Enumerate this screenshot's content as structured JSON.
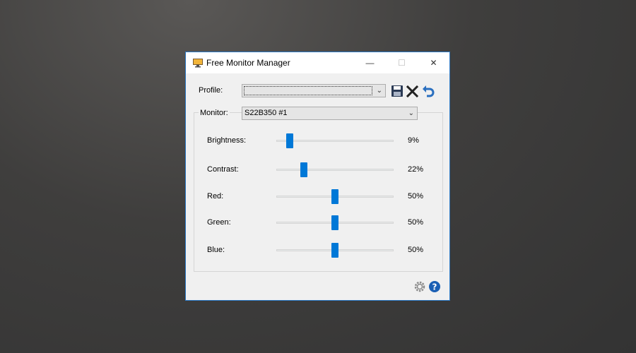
{
  "window": {
    "title": "Free Monitor Manager",
    "controls": {
      "minimize": "—",
      "maximize": "☐",
      "close": "✕"
    }
  },
  "profile": {
    "label": "Profile:",
    "value": "",
    "icons": [
      "save-icon",
      "delete-icon",
      "undo-icon"
    ]
  },
  "monitor": {
    "label": "Monitor:",
    "value": "S22B350 #1"
  },
  "sliders": [
    {
      "label": "Brightness:",
      "value": 9,
      "display": "9%"
    },
    {
      "label": "Contrast:",
      "value": 22,
      "display": "22%"
    },
    {
      "label": "Red:",
      "value": 50,
      "display": "50%"
    },
    {
      "label": "Green:",
      "value": 50,
      "display": "50%"
    },
    {
      "label": "Blue:",
      "value": 50,
      "display": "50%"
    }
  ],
  "colors": {
    "accent": "#0078d7",
    "help": "#1a5fb4"
  },
  "footer_icons": [
    "settings-gear-icon",
    "help-icon"
  ]
}
